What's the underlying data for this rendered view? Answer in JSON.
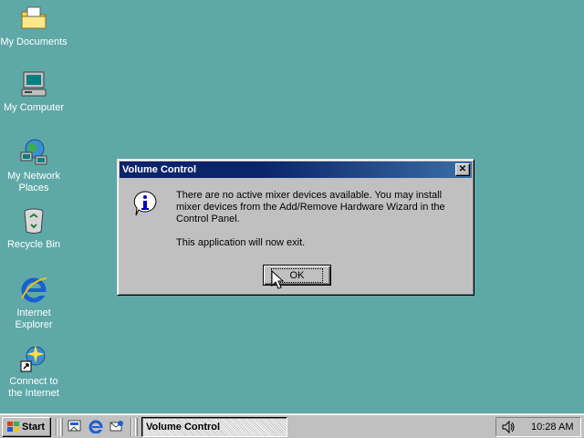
{
  "desktop": {
    "background": "#5fa8a8",
    "icons": [
      {
        "label": "My Documents",
        "icon": "folder-icon"
      },
      {
        "label": "My Computer",
        "icon": "computer-icon"
      },
      {
        "label": "My Network\nPlaces",
        "icon": "network-icon"
      },
      {
        "label": "Recycle Bin",
        "icon": "recycle-bin-icon"
      },
      {
        "label": "Internet\nExplorer",
        "icon": "internet-explorer-icon"
      },
      {
        "label": "Connect to\nthe Internet",
        "icon": "connect-internet-icon"
      }
    ]
  },
  "dialog": {
    "title": "Volume Control",
    "close_label": "✕",
    "icon": "info-icon",
    "message_line1": "There are no active mixer devices available. You may install mixer devices from the Add/Remove Hardware Wizard in the Control Panel.",
    "message_line2": "This application will now exit.",
    "ok_label": "OK"
  },
  "taskbar": {
    "start_label": "Start",
    "quick_launch": [
      "show-desktop-icon",
      "internet-explorer-icon",
      "outlook-express-icon"
    ],
    "task_button_label": "Volume Control",
    "tray_icon": "speaker-icon",
    "clock": "10:28 AM"
  }
}
